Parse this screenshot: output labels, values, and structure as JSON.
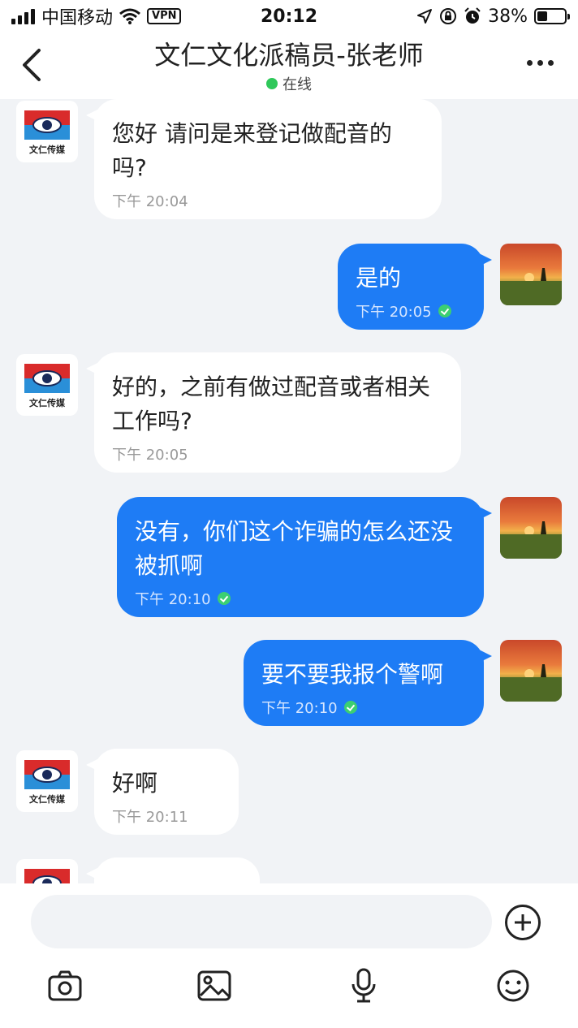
{
  "status_bar": {
    "carrier": "中国移动",
    "vpn": "VPN",
    "time": "20:12",
    "battery": "38%"
  },
  "header": {
    "title": "文仁文化派稿员-张老师",
    "status": "在线"
  },
  "avatar_logo_text": "文仁传媒",
  "messages": [
    {
      "dir": "in",
      "text": "您好 请问是来登记做配音的吗?",
      "time": "下午 20:04"
    },
    {
      "dir": "out",
      "text": "是的",
      "time": "下午 20:05"
    },
    {
      "dir": "in",
      "text": "好的，之前有做过配音或者相关工作吗?",
      "time": "下午 20:05"
    },
    {
      "dir": "out",
      "text": "没有，你们这个诈骗的怎么还没被抓啊",
      "time": "下午 20:10"
    },
    {
      "dir": "out",
      "text": "要不要我报个警啊",
      "time": "下午 20:10"
    },
    {
      "dir": "in",
      "text": "好啊",
      "time": "下午 20:11"
    }
  ],
  "input": {
    "placeholder": ""
  },
  "toolbar": {
    "icons": [
      "camera-icon",
      "image-icon",
      "microphone-icon",
      "emoji-icon"
    ]
  },
  "colors": {
    "bubble_out": "#1e7cf5",
    "bubble_in": "#ffffff",
    "background": "#f1f3f6",
    "online": "#2fc85a",
    "read_check": "#3ccf72"
  }
}
